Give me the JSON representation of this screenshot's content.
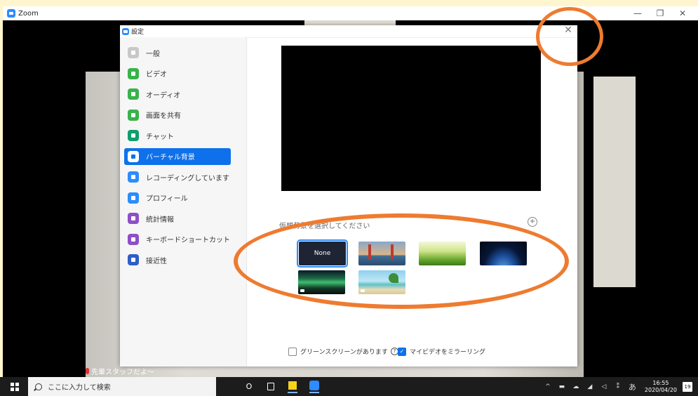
{
  "window": {
    "title": "Zoom",
    "controls": [
      "—",
      "❐",
      "✕"
    ]
  },
  "video": {
    "participant_name": "先輩スタッフだよ〜"
  },
  "settings": {
    "title": "設定",
    "close_label": "✕",
    "nav": [
      {
        "label": "一般",
        "icon": "gear-icon",
        "color": "#c8c8c8"
      },
      {
        "label": "ビデオ",
        "icon": "video-icon",
        "color": "#37b34a"
      },
      {
        "label": "オーディオ",
        "icon": "headphones-icon",
        "color": "#37b34a"
      },
      {
        "label": "画面を共有",
        "icon": "share-screen-icon",
        "color": "#37b34a"
      },
      {
        "label": "チャット",
        "icon": "chat-icon",
        "color": "#0e9f6e"
      },
      {
        "label": "バーチャル背景",
        "icon": "virtual-background-icon",
        "color": "#0e71eb",
        "active": true
      },
      {
        "label": "レコーディングしています",
        "icon": "record-icon",
        "color": "#2d8cff"
      },
      {
        "label": "プロフィール",
        "icon": "profile-icon",
        "color": "#2d8cff"
      },
      {
        "label": "統計情報",
        "icon": "statistics-icon",
        "color": "#8e4fc7"
      },
      {
        "label": "キーボードショートカット",
        "icon": "keyboard-icon",
        "color": "#8e4fc7"
      },
      {
        "label": "接近性",
        "icon": "accessibility-icon",
        "color": "#2d5fc7"
      }
    ],
    "virtual_bg": {
      "section_label": "仮想背景を選択してください",
      "add_label": "+",
      "thumbnails": [
        {
          "label": "None",
          "selected": true
        },
        {
          "label": ""
        },
        {
          "label": ""
        },
        {
          "label": ""
        },
        {
          "label": ""
        },
        {
          "label": ""
        }
      ]
    },
    "options": {
      "green_screen": {
        "label": "グリーンスクリーンがあります",
        "checked": false,
        "help": "?"
      },
      "mirror_video": {
        "label": "マイビデオをミラーリング",
        "checked": true,
        "check_glyph": "✓"
      }
    }
  },
  "taskbar": {
    "search_placeholder": "ここに入力して検索",
    "cortana_glyph": "O",
    "tray": {
      "chevron": "^",
      "ime": "あ",
      "time": "16:55",
      "date": "2020/04/20",
      "notifications": "19"
    }
  },
  "accent_colors": {
    "annotation": "#ee7b30",
    "zoom_blue": "#2d8cff"
  }
}
